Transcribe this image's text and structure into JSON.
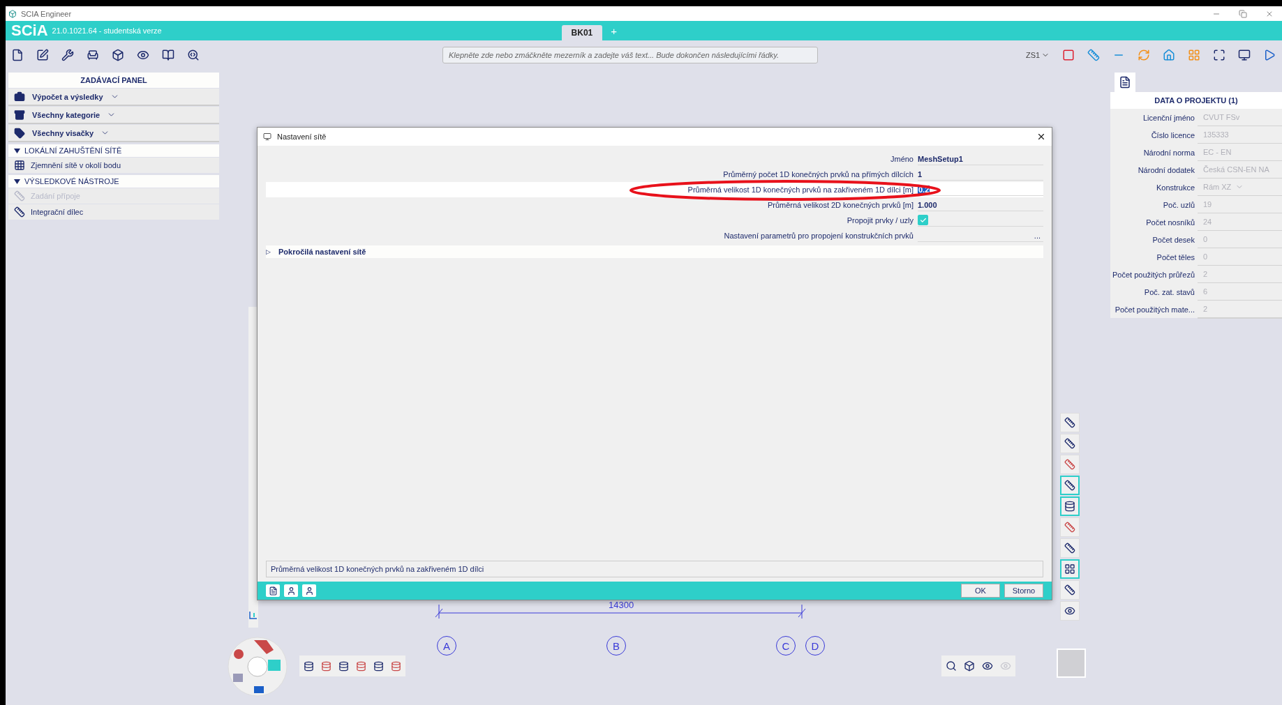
{
  "window": {
    "title": "SCIA Engineer"
  },
  "app_bar": {
    "logo": "SCiA",
    "version": "21.0.1021.64 - studentská verze",
    "tabs": [
      {
        "label": "BK01",
        "selected": true
      }
    ],
    "add_tab": "+"
  },
  "toolbar": {
    "command_placeholder": "Klepněte zde nebo zmáčkněte mezerník a zadejte váš text... Bude dokončen následujícími řádky.",
    "view_selector": "ZS1"
  },
  "input_panel": {
    "title": "ZADÁVACÍ PANEL",
    "filters": [
      "Výpočet a výsledky",
      "Všechny kategorie",
      "Všechny visačky"
    ],
    "sections": [
      {
        "title": "LOKÁLNÍ ZAHUŠTĚNÍ SÍTĚ",
        "expanded": true,
        "items": [
          {
            "label": "Zjemnění sítě v okolí bodu",
            "disabled": false
          }
        ]
      },
      {
        "title": "VÝSLEDKOVÉ NÁSTROJE",
        "expanded": true,
        "items": [
          {
            "label": "Zadání přípoje",
            "disabled": true
          },
          {
            "label": "Integrační dílec",
            "disabled": false
          }
        ]
      }
    ]
  },
  "dialog": {
    "title": "Nastavení sítě",
    "rows": [
      {
        "kind": "text",
        "label": "Jméno",
        "value": "MeshSetup1",
        "selected": false
      },
      {
        "kind": "text",
        "label": "Průměrný počet 1D konečných prvků na přímých dílcích",
        "value": "1",
        "selected": false
      },
      {
        "kind": "text",
        "label": "Průměrná velikost 1D konečných prvků na zakřiveném 1D dílci [m]",
        "value": "0.2",
        "selected": true
      },
      {
        "kind": "text",
        "label": "Průměrná velikost 2D konečných prvků [m]",
        "value": "1.000",
        "selected": false
      },
      {
        "kind": "checkbox",
        "label": "Propojit prvky / uzly",
        "checked": true,
        "selected": false
      },
      {
        "kind": "ellipsis",
        "label": "Nastavení parametrů pro propojení konstrukčních prvků",
        "value": "...",
        "selected": false
      }
    ],
    "advanced": {
      "label": "Pokročilá nastavení sítě",
      "expanded": false,
      "toggle": "▷"
    },
    "description": "Průměrná velikost 1D konečných prvků na zakřiveném 1D dílci",
    "buttons": [
      "OK",
      "Storno"
    ]
  },
  "project_data": {
    "title": "DATA O PROJEKTU (1)",
    "rows": [
      {
        "kind": "text",
        "label": "Licenční jméno",
        "value": "CVUT FSv"
      },
      {
        "kind": "text",
        "label": "Číslo licence",
        "value": "135333"
      },
      {
        "kind": "text",
        "label": "Národní norma",
        "value": "EC - EN"
      },
      {
        "kind": "text",
        "label": "Národní dodatek",
        "value": "Česká CSN-EN NA"
      },
      {
        "kind": "dropdown",
        "label": "Konstrukce",
        "value": "Rám XZ"
      },
      {
        "kind": "text",
        "label": "Poč. uzlů",
        "value": "19"
      },
      {
        "kind": "text",
        "label": "Počet nosníků",
        "value": "24"
      },
      {
        "kind": "text",
        "label": "Počet desek",
        "value": "0"
      },
      {
        "kind": "text",
        "label": "Počet těles",
        "value": "0"
      },
      {
        "kind": "text",
        "label": "Počet použitých průřezů",
        "value": "2"
      },
      {
        "kind": "text",
        "label": "Poč. zat. stavů",
        "value": "6"
      },
      {
        "kind": "text",
        "label": "Počet použitých mate...",
        "value": "2"
      }
    ]
  },
  "canvas": {
    "dimension": "14300",
    "grid_axes": [
      "A",
      "B",
      "C",
      "D"
    ]
  }
}
